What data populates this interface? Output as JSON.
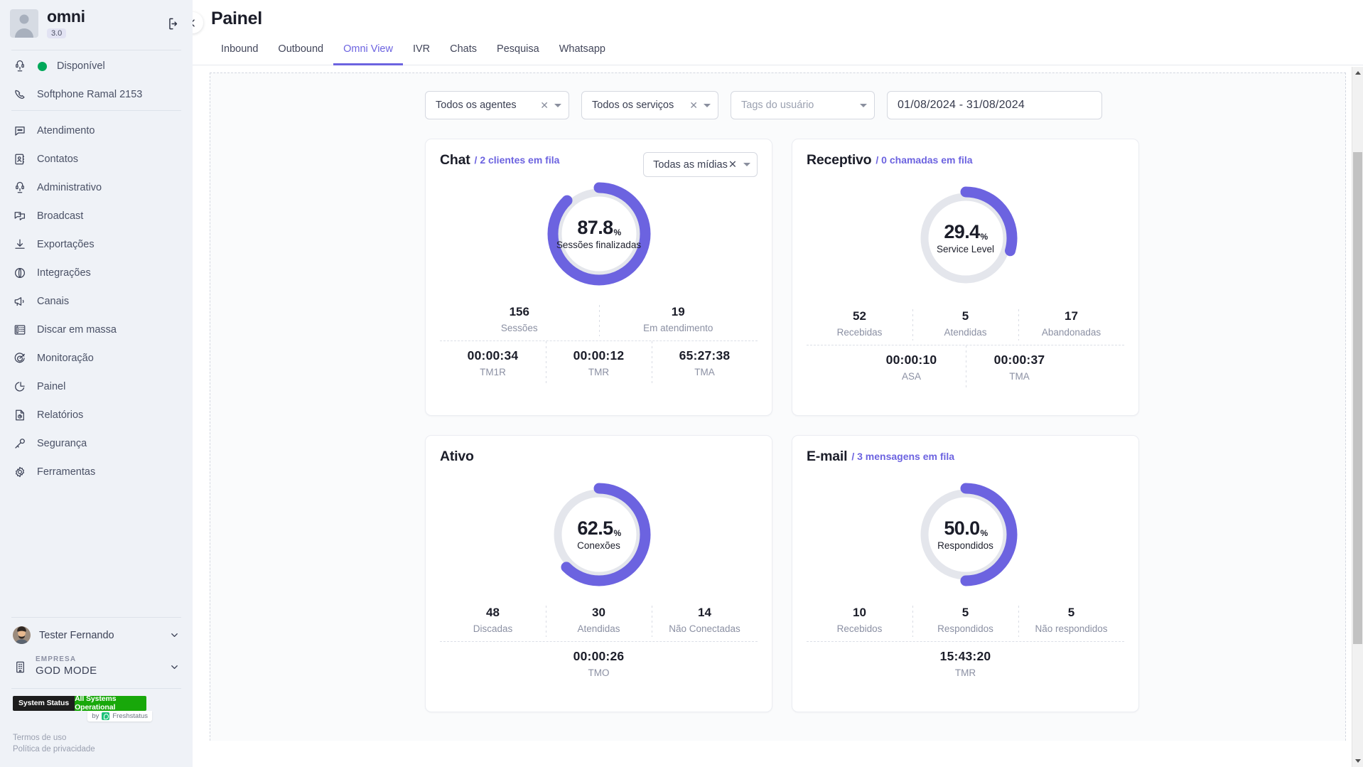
{
  "sidebar": {
    "brand": {
      "name": "omni",
      "version": "3.0"
    },
    "logout_icon": "logout-icon",
    "status": {
      "label": "Disponível",
      "color": "#00a859"
    },
    "softphone": {
      "label": "Softphone Ramal 2153"
    },
    "items": [
      {
        "label": "Atendimento",
        "icon": "chat-bubble-icon"
      },
      {
        "label": "Contatos",
        "icon": "contact-book-icon"
      },
      {
        "label": "Administrativo",
        "icon": "headset-chair-icon"
      },
      {
        "label": "Broadcast",
        "icon": "broadcast-icon"
      },
      {
        "label": "Exportações",
        "icon": "download-icon"
      },
      {
        "label": "Integrações",
        "icon": "globe-icon"
      },
      {
        "label": "Canais",
        "icon": "megaphone-icon"
      },
      {
        "label": "Discar em massa",
        "icon": "dialer-icon"
      },
      {
        "label": "Monitoração",
        "icon": "target-icon"
      },
      {
        "label": "Painel",
        "icon": "pie-chart-icon"
      },
      {
        "label": "Relatórios",
        "icon": "report-doc-icon"
      },
      {
        "label": "Segurança",
        "icon": "key-icon"
      },
      {
        "label": "Ferramentas",
        "icon": "gear-icon"
      }
    ],
    "user": {
      "name": "Tester Fernando"
    },
    "company": {
      "label": "EMPRESA",
      "name": "GOD MODE"
    },
    "system_status": {
      "left": "System Status",
      "right": "All Systems Operational",
      "by": "by",
      "provider": "Freshstatus"
    },
    "legal": {
      "terms": "Termos de uso",
      "privacy": "Política de privacidade"
    }
  },
  "header": {
    "title": "Painel",
    "collapse_icon": "chevron-left-icon",
    "tabs": [
      {
        "label": "Inbound",
        "active": false
      },
      {
        "label": "Outbound",
        "active": false
      },
      {
        "label": "Omni View",
        "active": true
      },
      {
        "label": "IVR",
        "active": false
      },
      {
        "label": "Chats",
        "active": false
      },
      {
        "label": "Pesquisa",
        "active": false
      },
      {
        "label": "Whatsapp",
        "active": false
      }
    ]
  },
  "filters": {
    "agents": {
      "value": "Todos os agentes",
      "clearable": true
    },
    "services": {
      "value": "Todos os serviços",
      "clearable": true
    },
    "tags": {
      "placeholder": "Tags do usuário",
      "value": ""
    },
    "date_range": {
      "value": "01/08/2024 - 31/08/2024"
    }
  },
  "accent": {
    "purple": "#6c63e0",
    "track": "#e4e6ec"
  },
  "chart_data": [
    {
      "type": "pie",
      "title": "Chat",
      "subtitle": "/ 2 clientes em fila",
      "media_filter": "Todas as mídias",
      "center_value": "87.8",
      "center_unit": "%",
      "center_label": "Sessões finalizadas",
      "percent": 87.8,
      "track_color": "#e4e6ec",
      "value_color": "#6c63e0",
      "stats": [
        {
          "value": "156",
          "label": "Sessões"
        },
        {
          "value": "19",
          "label": "Em atendimento"
        }
      ],
      "times": [
        {
          "value": "00:00:34",
          "label": "TM1R"
        },
        {
          "value": "00:00:12",
          "label": "TMR"
        },
        {
          "value": "65:27:38",
          "label": "TMA"
        }
      ]
    },
    {
      "type": "pie",
      "title": "Receptivo",
      "subtitle": "/ 0 chamadas em fila",
      "center_value": "29.4",
      "center_unit": "%",
      "center_label": "Service Level",
      "percent": 29.4,
      "track_color": "#e4e6ec",
      "value_color": "#6c63e0",
      "stats": [
        {
          "value": "52",
          "label": "Recebidas"
        },
        {
          "value": "5",
          "label": "Atendidas"
        },
        {
          "value": "17",
          "label": "Abandonadas"
        }
      ],
      "times": [
        {
          "value": "00:00:10",
          "label": "ASA"
        },
        {
          "value": "00:00:37",
          "label": "TMA"
        }
      ]
    },
    {
      "type": "pie",
      "title": "Ativo",
      "subtitle": "",
      "center_value": "62.5",
      "center_unit": "%",
      "center_label": "Conexões",
      "percent": 62.5,
      "track_color": "#e4e6ec",
      "value_color": "#6c63e0",
      "stats": [
        {
          "value": "48",
          "label": "Discadas"
        },
        {
          "value": "30",
          "label": "Atendidas"
        },
        {
          "value": "14",
          "label": "Não Conectadas"
        }
      ],
      "times": [
        {
          "value": "00:00:26",
          "label": "TMO"
        }
      ]
    },
    {
      "type": "pie",
      "title": "E-mail",
      "subtitle": "/ 3 mensagens em fila",
      "center_value": "50.0",
      "center_unit": "%",
      "center_label": "Respondidos",
      "percent": 50.0,
      "track_color": "#e4e6ec",
      "value_color": "#6c63e0",
      "stats": [
        {
          "value": "10",
          "label": "Recebidos"
        },
        {
          "value": "5",
          "label": "Respondidos"
        },
        {
          "value": "5",
          "label": "Não respondidos"
        }
      ],
      "times": [
        {
          "value": "15:43:20",
          "label": "TMR"
        }
      ]
    }
  ]
}
